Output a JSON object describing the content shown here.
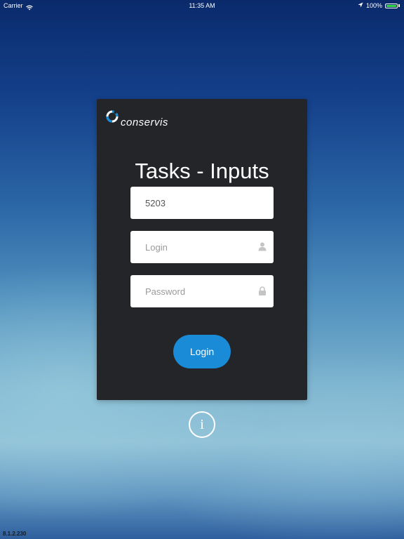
{
  "status_bar": {
    "carrier": "Carrier",
    "time": "11:35 AM",
    "battery_percent": "100%",
    "battery_level": 1.0,
    "icons": [
      "wifi-icon",
      "location-arrow-icon",
      "battery-icon"
    ]
  },
  "login_card": {
    "logo_text": "conservis",
    "title": "Tasks - Inputs",
    "account_field": {
      "value": "5203"
    },
    "login_field": {
      "value": "",
      "placeholder": "Login",
      "icon": "user-icon"
    },
    "password_field": {
      "value": "",
      "placeholder": "Password",
      "icon": "lock-icon"
    },
    "login_button_label": "Login"
  },
  "info_button": {
    "label": "i",
    "icon": "info-icon"
  },
  "version": "8.1.2.230",
  "colors": {
    "card_background": "#232529",
    "button_accent": "#1a8bd6",
    "battery_green": "#33d44a",
    "logo_blue": "#1a8bd6"
  }
}
